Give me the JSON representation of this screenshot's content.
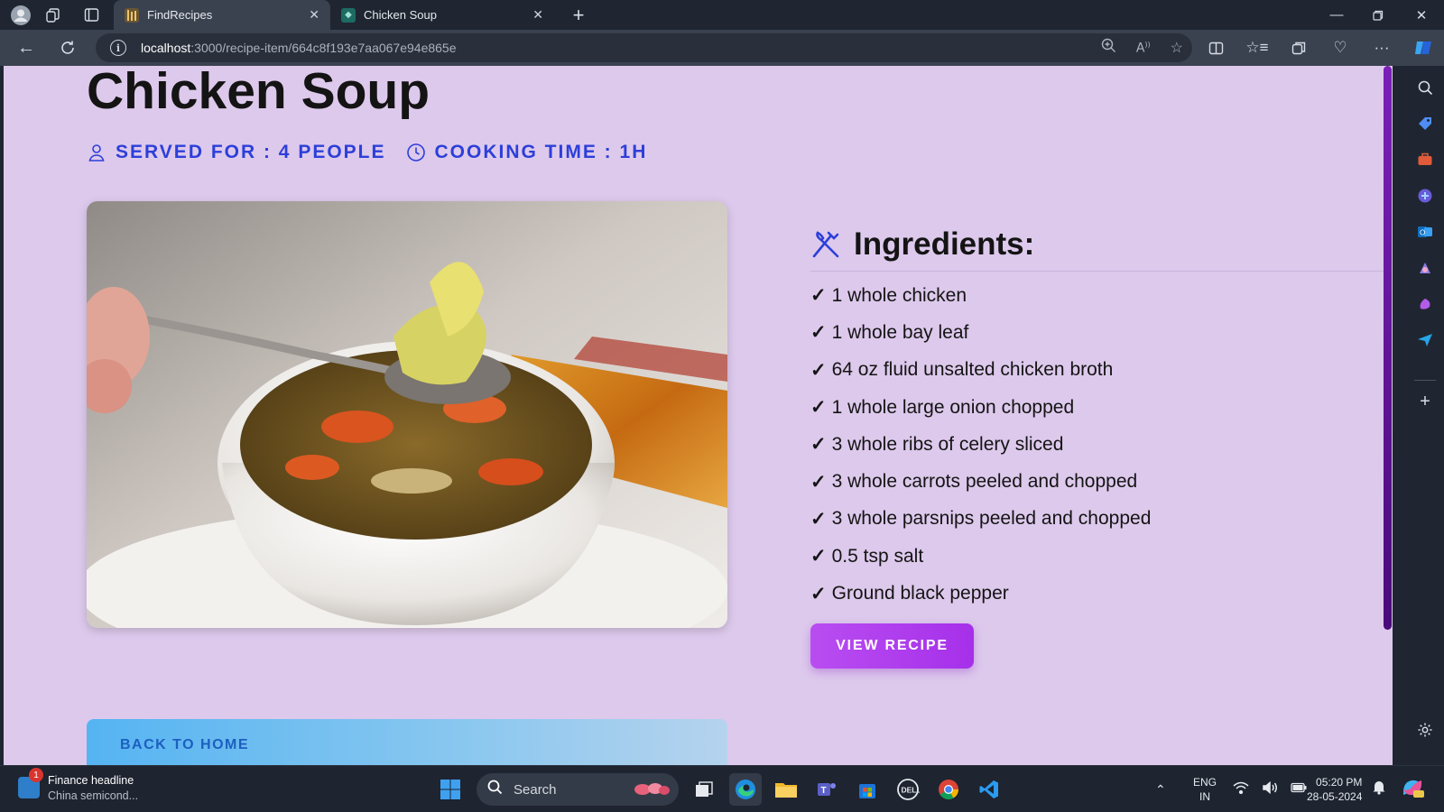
{
  "browser": {
    "tabs": [
      {
        "title": "FindRecipes",
        "active": true
      },
      {
        "title": "Chicken Soup",
        "active": false
      }
    ],
    "url_host": "localhost",
    "url_path": ":3000/recipe-item/664c8f193e7aa067e94e865e"
  },
  "page": {
    "title": "Chicken Soup",
    "served_for": "SERVED FOR : 4 PEOPLE",
    "cooking_time": "COOKING TIME : 1H",
    "ingredients_heading": "Ingredients:",
    "check_mark": "✓",
    "ingredients": [
      "1 whole chicken",
      "1 whole bay leaf",
      "64 oz fluid unsalted chicken broth",
      "1 whole large onion chopped",
      "3 whole ribs of celery sliced",
      "3 whole carrots peeled and chopped",
      "3 whole parsnips peeled and chopped",
      "0.5 tsp salt",
      "Ground black pepper"
    ],
    "view_recipe_label": "VIEW RECIPE",
    "back_home_label": "BACK TO HOME",
    "accent_color": "#2d3fd9",
    "button_color": "#a630ea"
  },
  "taskbar": {
    "news_headline": "Finance headline",
    "news_sub": "China semicond...",
    "news_badge": "1",
    "search_label": "Search",
    "lang_line1": "ENG",
    "lang_line2": "IN",
    "time": "05:20 PM",
    "date": "28-05-2024"
  }
}
